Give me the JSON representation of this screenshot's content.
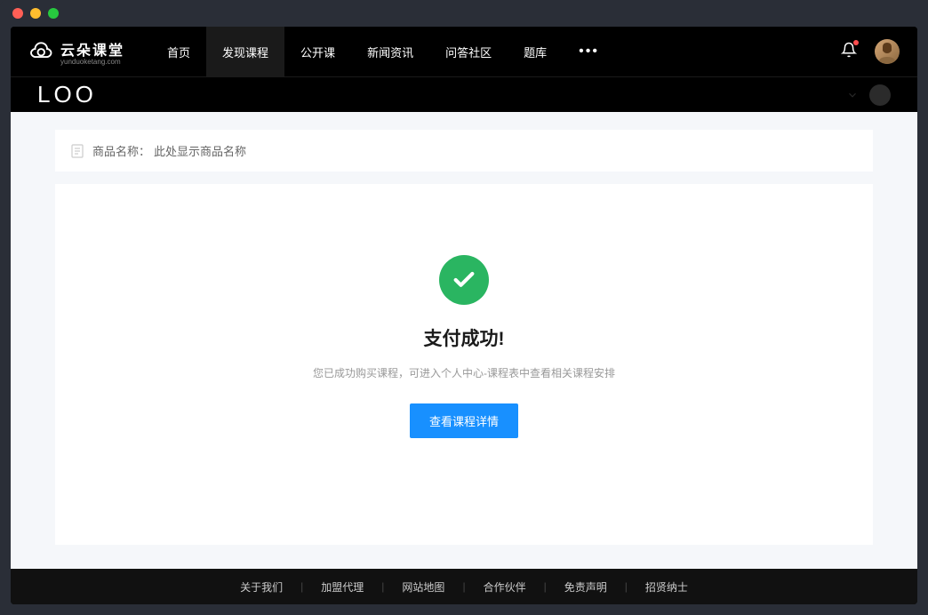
{
  "logo": {
    "main": "云朵课堂",
    "sub": "yunduoketang.com"
  },
  "nav": {
    "items": [
      {
        "label": "首页",
        "active": false
      },
      {
        "label": "发现课程",
        "active": true
      },
      {
        "label": "公开课",
        "active": false
      },
      {
        "label": "新闻资讯",
        "active": false
      },
      {
        "label": "问答社区",
        "active": false
      },
      {
        "label": "题库",
        "active": false
      }
    ],
    "more": "•••"
  },
  "subheader": {
    "text": "LOO"
  },
  "product": {
    "label": "商品名称：",
    "name": "此处显示商品名称"
  },
  "success": {
    "title": "支付成功!",
    "description": "您已成功购买课程，可进入个人中心-课程表中查看相关课程安排",
    "button": "查看课程详情"
  },
  "footer": {
    "links": [
      "关于我们",
      "加盟代理",
      "网站地图",
      "合作伙伴",
      "免责声明",
      "招贤纳士"
    ]
  }
}
